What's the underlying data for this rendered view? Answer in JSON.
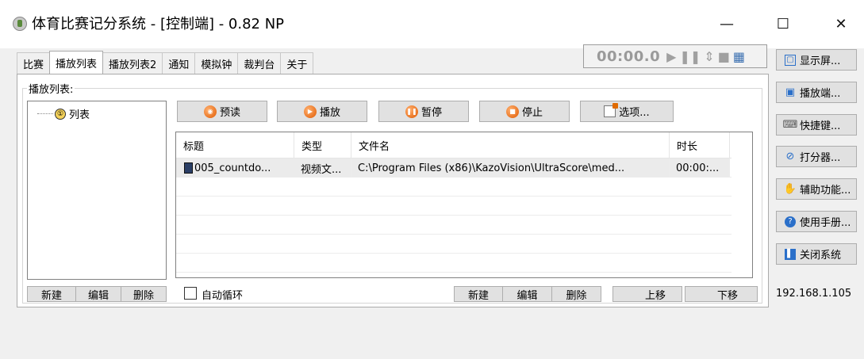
{
  "window": {
    "title": "体育比赛记分系统 - [控制端] - 0.82 NP",
    "minimize": "—",
    "maximize": "☐",
    "close": "✕"
  },
  "tabs": [
    "比赛",
    "播放列表",
    "播放列表2",
    "通知",
    "模拟钟",
    "裁判台",
    "关于"
  ],
  "active_tab": "播放列表",
  "clock": {
    "time": "00:00.0",
    "icons": [
      "play-icon",
      "pause-icon",
      "updown-icon",
      "stop-icon",
      "grid-icon"
    ]
  },
  "playlist": {
    "group_label": "播放列表:",
    "tree": {
      "num": "①",
      "label": "列表"
    },
    "tree_buttons": {
      "new": "新建",
      "edit": "编辑",
      "delete": "删除"
    },
    "actions": {
      "preload": "预读",
      "play": "播放",
      "pause": "暂停",
      "stop": "停止",
      "options": "选项..."
    },
    "columns": [
      "标题",
      "类型",
      "文件名",
      "时长"
    ],
    "rows": [
      {
        "title": "005_countdo...",
        "type": "视频文...",
        "file": "C:\\Program Files (x86)\\KazoVision\\UltraScore\\med...",
        "duration": "00:00:..."
      }
    ],
    "autoloop": "自动循环",
    "list_buttons": {
      "new": "新建",
      "edit": "编辑",
      "delete": "删除",
      "up": "上移",
      "down": "下移"
    }
  },
  "side_buttons": [
    "显示屏...",
    "播放端...",
    "快捷键...",
    "打分器...",
    "辅助功能...",
    "使用手册...",
    "关闭系统"
  ],
  "ip": "192.168.1.105",
  "colors": {
    "accent": "#e05a00",
    "clock_text": "#9a9a9a",
    "panel": "#ffffff",
    "chrome": "#f0f0f0"
  }
}
